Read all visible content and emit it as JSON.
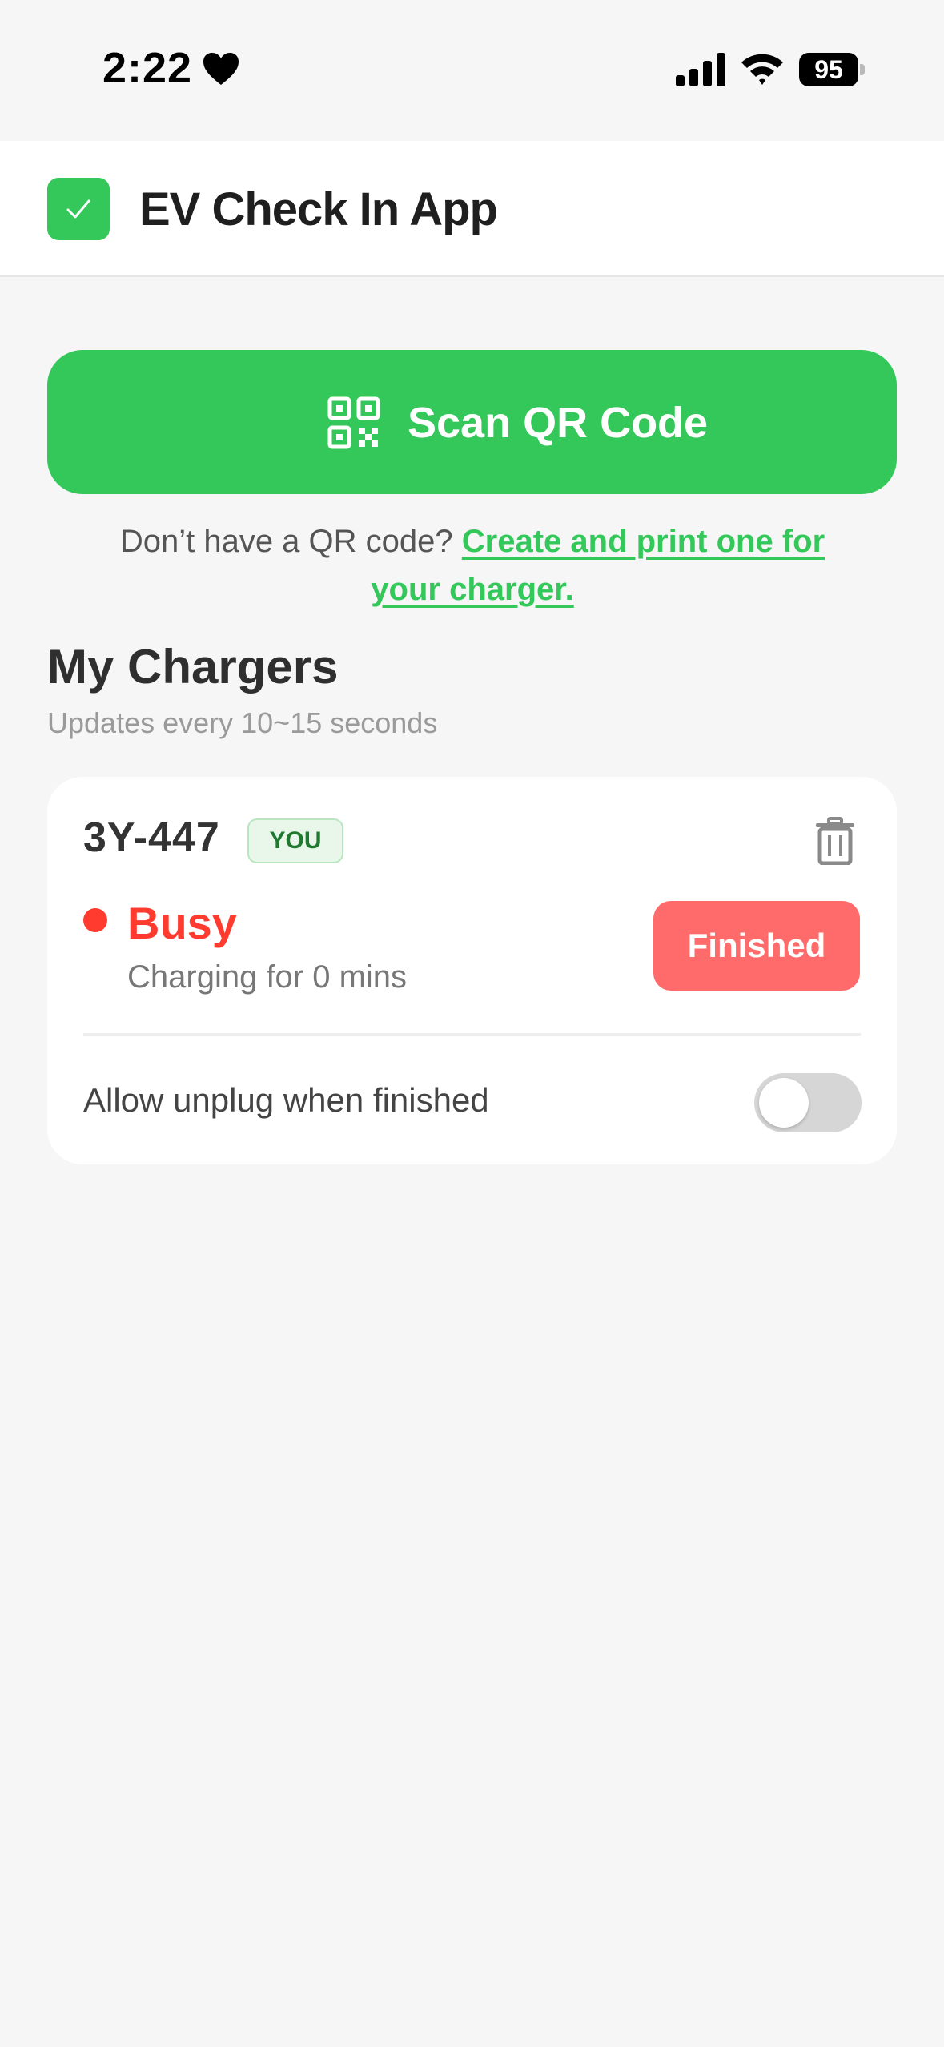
{
  "status_bar": {
    "time": "2:22",
    "battery": "95"
  },
  "header": {
    "title": "EV Check In App"
  },
  "scan": {
    "label": "Scan QR Code"
  },
  "helper": {
    "prefix": "Don’t have a QR code?",
    "link": "Create and print one for your charger."
  },
  "section": {
    "title": "My Chargers",
    "subtitle": "Updates every 10~15 seconds"
  },
  "charger": {
    "id": "3Y-447",
    "badge": "YOU",
    "status": "Busy",
    "detail": "Charging for 0 mins",
    "action_label": "Finished",
    "allow_unplug_label": "Allow unplug when finished",
    "allow_unplug_enabled": false
  },
  "colors": {
    "brand_green": "#34c759",
    "busy_red": "#ff3b30",
    "finished_button": "#ff6b6b"
  },
  "icons": [
    "heart-icon",
    "signal-icon",
    "wifi-icon",
    "battery-icon",
    "checkmark-icon",
    "qr-code-icon",
    "trash-icon"
  ]
}
